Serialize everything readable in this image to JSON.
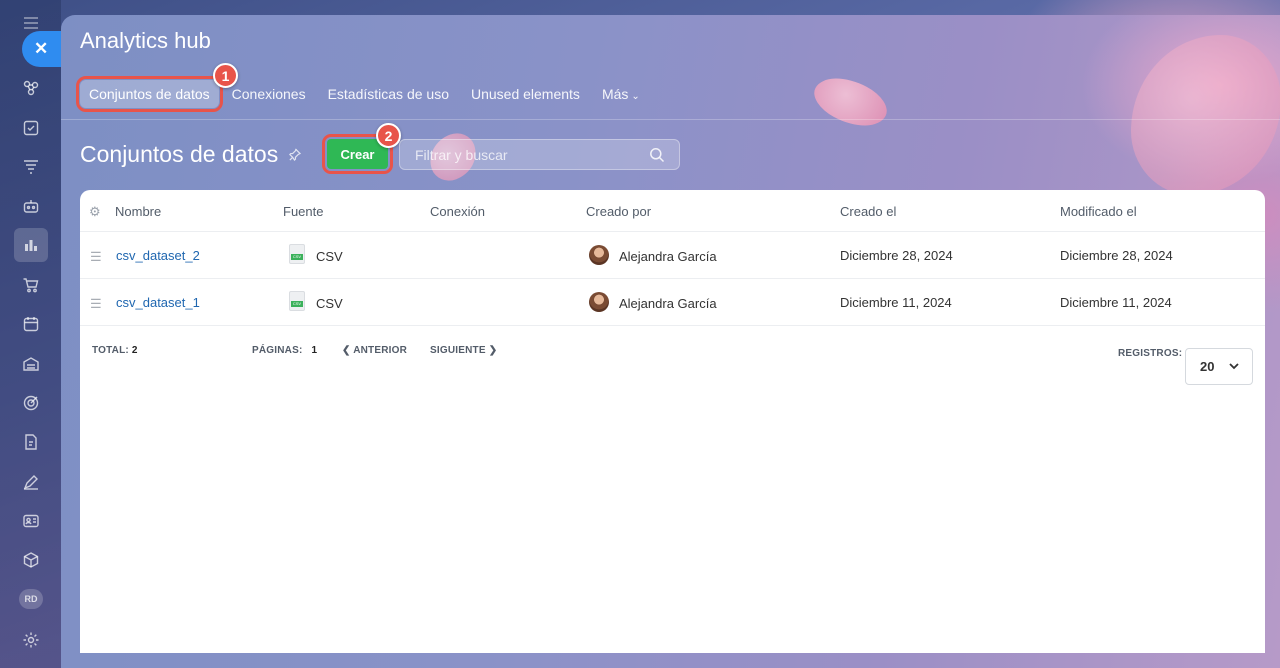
{
  "app": {
    "title": "Analytics hub"
  },
  "tabs": [
    {
      "label": "Conjuntos de datos",
      "active": true
    },
    {
      "label": "Conexiones"
    },
    {
      "label": "Estadísticas de uso"
    },
    {
      "label": "Unused elements"
    },
    {
      "label": "Más"
    }
  ],
  "badges": {
    "first": "1",
    "second": "2"
  },
  "page": {
    "title": "Conjuntos de datos",
    "create_label": "Crear",
    "search_placeholder": "Filtrar y buscar"
  },
  "table": {
    "columns": [
      "Nombre",
      "Fuente",
      "Conexión",
      "Creado por",
      "Creado el",
      "Modificado el"
    ],
    "rows": [
      {
        "name": "csv_dataset_2",
        "source": "CSV",
        "connection": "",
        "created_by": "Alejandra García",
        "created": "Diciembre 28, 2024",
        "modified": "Diciembre 28, 2024"
      },
      {
        "name": "csv_dataset_1",
        "source": "CSV",
        "connection": "",
        "created_by": "Alejandra García",
        "created": "Diciembre 11, 2024",
        "modified": "Diciembre 11, 2024"
      }
    ]
  },
  "footer": {
    "total_label": "TOTAL:",
    "total_value": "2",
    "pages_label": "PÁGINAS:",
    "pages_value": "1",
    "prev_label": "ANTERIOR",
    "next_label": "SIGUIENTE",
    "records_label": "REGISTROS:",
    "records_value": "20"
  },
  "sidebar": {
    "user_initials": "RD"
  },
  "colors": {
    "accent": "#2fb855",
    "highlight": "#e8544a",
    "link": "#2067b0",
    "rail_active": "#2f8cf0"
  }
}
